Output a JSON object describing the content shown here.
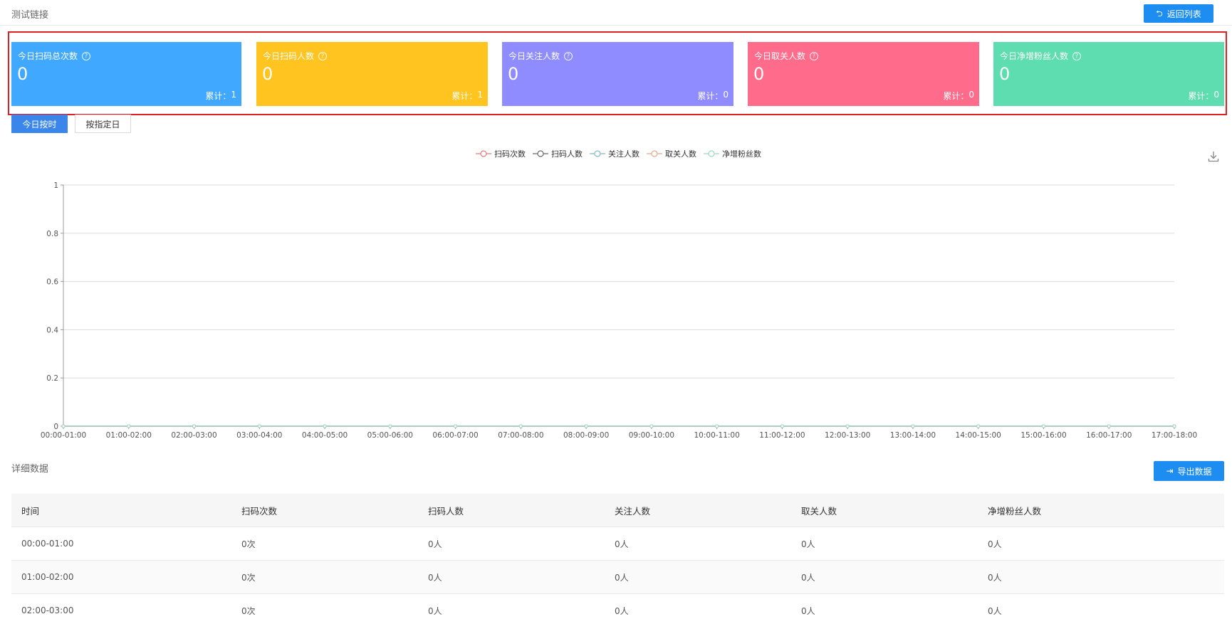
{
  "header": {
    "title": "测试链接",
    "back_label": "返回列表"
  },
  "stats": [
    {
      "title": "今日扫码总次数",
      "value": "0",
      "total_label": "累计：",
      "total_value": "1",
      "color": "#40a9ff"
    },
    {
      "title": "今日扫码人数",
      "value": "0",
      "total_label": "累计：",
      "total_value": "1",
      "color": "#ffc41f"
    },
    {
      "title": "今日关注人数",
      "value": "0",
      "total_label": "累计：",
      "total_value": "0",
      "color": "#8f8cff"
    },
    {
      "title": "今日取关人数",
      "value": "0",
      "total_label": "累计：",
      "total_value": "0",
      "color": "#ff6b8b"
    },
    {
      "title": "今日净增粉丝人数",
      "value": "0",
      "total_label": "累计：",
      "total_value": "0",
      "color": "#5dddb0"
    }
  ],
  "mode": {
    "active": "今日按时",
    "inactive": "按指定日"
  },
  "legend": [
    {
      "name": "扫码次数",
      "color": "#e07b7b"
    },
    {
      "name": "扫码人数",
      "color": "#666666"
    },
    {
      "name": "关注人数",
      "color": "#85b8c9"
    },
    {
      "name": "取关人数",
      "color": "#e8a98a"
    },
    {
      "name": "净增粉丝数",
      "color": "#9fd8c8"
    }
  ],
  "chart_data": {
    "type": "line",
    "categories": [
      "00:00-01:00",
      "01:00-02:00",
      "02:00-03:00",
      "03:00-04:00",
      "04:00-05:00",
      "05:00-06:00",
      "06:00-07:00",
      "07:00-08:00",
      "08:00-09:00",
      "09:00-10:00",
      "10:00-11:00",
      "11:00-12:00",
      "12:00-13:00",
      "13:00-14:00",
      "14:00-15:00",
      "15:00-16:00",
      "16:00-17:00",
      "17:00-18:00"
    ],
    "series": [
      {
        "name": "扫码次数",
        "values": [
          0,
          0,
          0,
          0,
          0,
          0,
          0,
          0,
          0,
          0,
          0,
          0,
          0,
          0,
          0,
          0,
          0,
          0
        ]
      },
      {
        "name": "扫码人数",
        "values": [
          0,
          0,
          0,
          0,
          0,
          0,
          0,
          0,
          0,
          0,
          0,
          0,
          0,
          0,
          0,
          0,
          0,
          0
        ]
      },
      {
        "name": "关注人数",
        "values": [
          0,
          0,
          0,
          0,
          0,
          0,
          0,
          0,
          0,
          0,
          0,
          0,
          0,
          0,
          0,
          0,
          0,
          0
        ]
      },
      {
        "name": "取关人数",
        "values": [
          0,
          0,
          0,
          0,
          0,
          0,
          0,
          0,
          0,
          0,
          0,
          0,
          0,
          0,
          0,
          0,
          0,
          0
        ]
      },
      {
        "name": "净增粉丝数",
        "values": [
          0,
          0,
          0,
          0,
          0,
          0,
          0,
          0,
          0,
          0,
          0,
          0,
          0,
          0,
          0,
          0,
          0,
          0
        ]
      }
    ],
    "yticks": [
      "0",
      "0.2",
      "0.4",
      "0.6",
      "0.8",
      "1"
    ],
    "ylim": [
      0,
      1
    ],
    "grid": true,
    "legend_position": "top-center"
  },
  "detail": {
    "title": "详细数据",
    "export_label": "导出数据",
    "columns": [
      "时间",
      "扫码次数",
      "扫码人数",
      "关注人数",
      "取关人数",
      "净增粉丝人数"
    ],
    "rows": [
      [
        "00:00-01:00",
        "0次",
        "0人",
        "0人",
        "0人",
        "0人"
      ],
      [
        "01:00-02:00",
        "0次",
        "0人",
        "0人",
        "0人",
        "0人"
      ],
      [
        "02:00-03:00",
        "0次",
        "0人",
        "0人",
        "0人",
        "0人"
      ]
    ]
  }
}
